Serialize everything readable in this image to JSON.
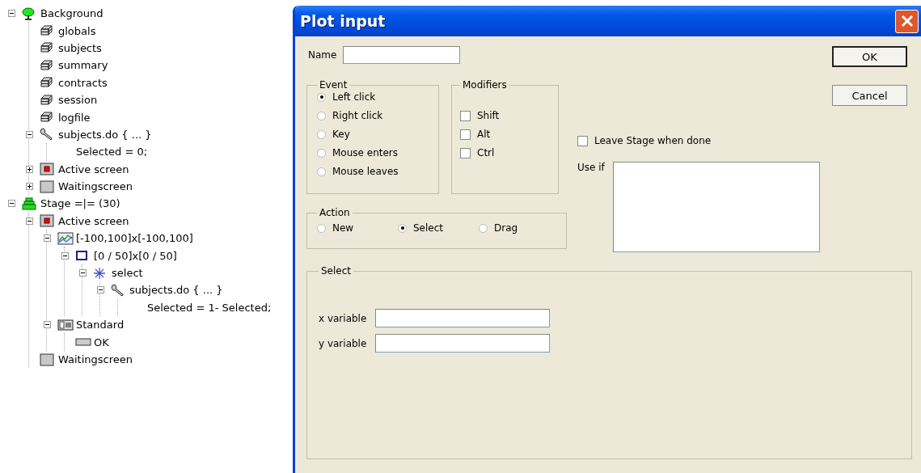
{
  "tree": [
    {
      "label": "Background",
      "kind": "tree",
      "expanded": true,
      "children": [
        {
          "label": "globals",
          "kind": "table"
        },
        {
          "label": "subjects",
          "kind": "table"
        },
        {
          "label": "summary",
          "kind": "table"
        },
        {
          "label": "contracts",
          "kind": "table"
        },
        {
          "label": "session",
          "kind": "table"
        },
        {
          "label": "logfile",
          "kind": "table"
        },
        {
          "label": "subjects.do {  ... }",
          "kind": "program",
          "expanded": true,
          "children": [
            {
              "label": "Selected = 0;",
              "kind": "code"
            }
          ]
        },
        {
          "label": "Active screen",
          "kind": "active-screen",
          "expanded": false
        },
        {
          "label": "Waitingscreen",
          "kind": "screen",
          "expanded": false
        }
      ]
    },
    {
      "label": "Stage =|= (30)",
      "kind": "stage",
      "expanded": true,
      "children": [
        {
          "label": "Active screen",
          "kind": "active-screen",
          "expanded": true,
          "children": [
            {
              "label": "[-100,100]x[-100,100]",
              "kind": "plot",
              "expanded": true,
              "children": [
                {
                  "label": "[0 / 50]x[0 / 50]",
                  "kind": "rect",
                  "expanded": true,
                  "children": [
                    {
                      "label": "select",
                      "kind": "plot-input",
                      "expanded": true,
                      "children": [
                        {
                          "label": "subjects.do {  ... }",
                          "kind": "program",
                          "expanded": true,
                          "children": [
                            {
                              "label": "Selected = 1- Selected;",
                              "kind": "code"
                            }
                          ]
                        }
                      ]
                    }
                  ]
                }
              ]
            },
            {
              "label": "Standard",
              "kind": "box",
              "expanded": true,
              "children": [
                {
                  "label": "OK",
                  "kind": "button"
                }
              ]
            }
          ]
        },
        {
          "label": "Waitingscreen",
          "kind": "screen"
        }
      ]
    }
  ],
  "dialog": {
    "title": "Plot input",
    "name": {
      "label": "Name"
    },
    "event": {
      "title": "Event",
      "options": [
        {
          "label": "Left click",
          "selected": true
        },
        {
          "label": "Right click",
          "selected": false
        },
        {
          "label": "Key",
          "selected": false
        },
        {
          "label": "Mouse enters",
          "selected": false
        },
        {
          "label": "Mouse leaves",
          "selected": false
        }
      ]
    },
    "modifiers": {
      "title": "Modifiers",
      "options": [
        {
          "label": "Shift",
          "checked": false
        },
        {
          "label": "Alt",
          "checked": false
        },
        {
          "label": "Ctrl",
          "checked": false
        }
      ]
    },
    "action": {
      "title": "Action",
      "options": [
        {
          "label": "New",
          "selected": false
        },
        {
          "label": "Select",
          "selected": true
        },
        {
          "label": "Drag",
          "selected": false
        }
      ]
    },
    "leave_stage": {
      "label": "Leave Stage when done",
      "checked": false
    },
    "use_if": {
      "label": "Use if"
    },
    "buttons": [
      {
        "label": "OK",
        "default": true
      },
      {
        "label": "Cancel",
        "default": false
      }
    ],
    "select": {
      "title": "Select",
      "fields": [
        {
          "label": "x variable"
        },
        {
          "label": "y variable"
        }
      ]
    }
  }
}
